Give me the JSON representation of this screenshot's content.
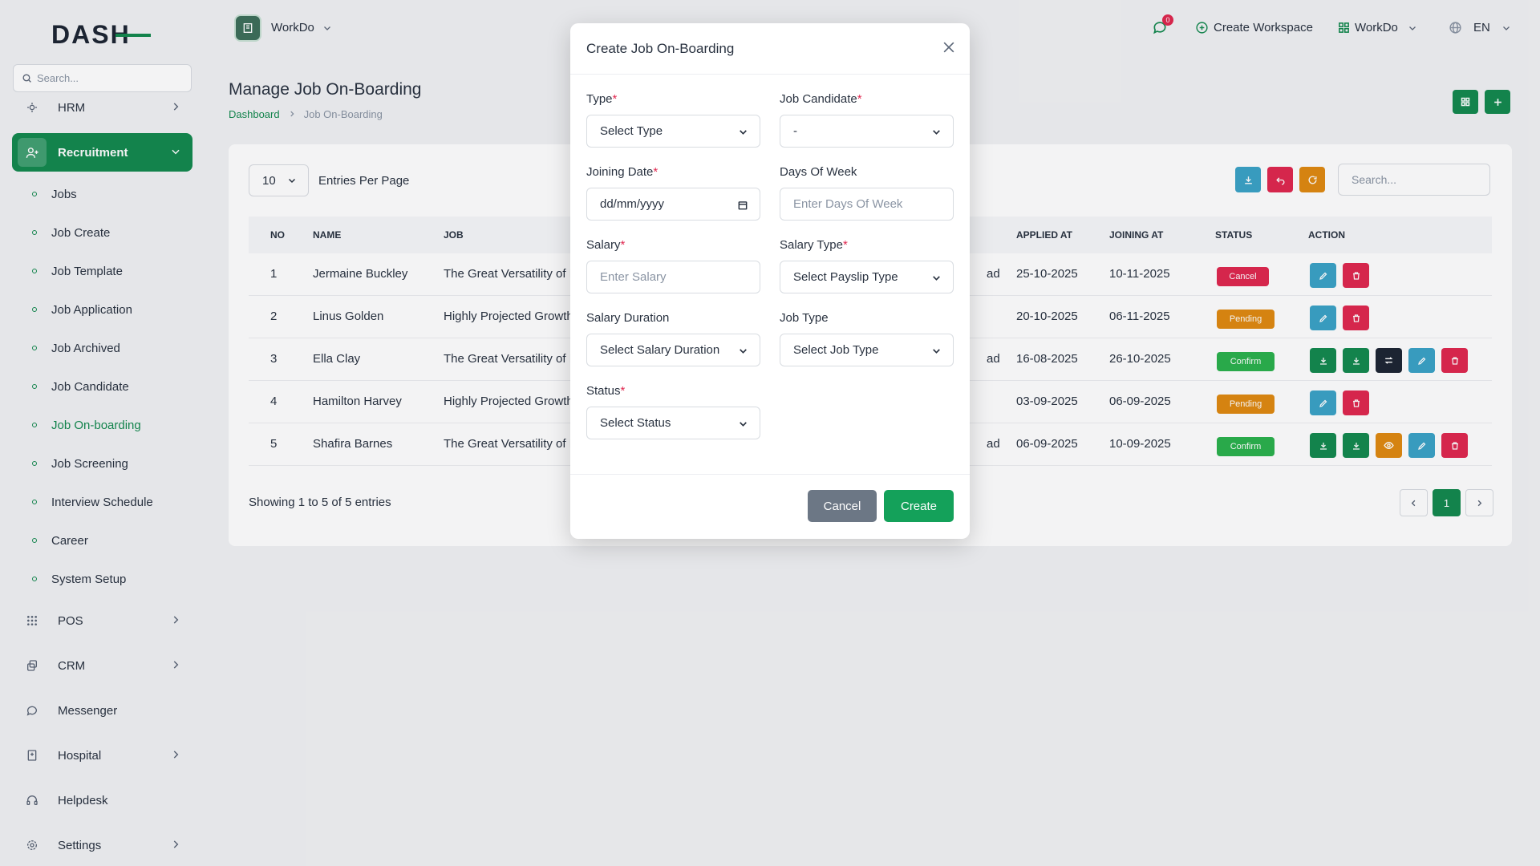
{
  "brand": {
    "logo_text": "DASH"
  },
  "sidebar": {
    "search_placeholder": "Search...",
    "items": [
      {
        "label": "HRM"
      },
      {
        "label": "Recruitment"
      },
      {
        "label": "POS"
      },
      {
        "label": "CRM"
      },
      {
        "label": "Messenger"
      },
      {
        "label": "Hospital"
      },
      {
        "label": "Helpdesk"
      },
      {
        "label": "Settings"
      }
    ],
    "sub_items": [
      "Jobs",
      "Job Create",
      "Job Template",
      "Job Application",
      "Job Archived",
      "Job Candidate",
      "Job On-boarding",
      "Job Screening",
      "Interview Schedule",
      "Career",
      "System Setup"
    ]
  },
  "topbar": {
    "workspace": "WorkDo",
    "notifications": "0",
    "create_workspace": "Create Workspace",
    "workspace2": "WorkDo",
    "language": "EN"
  },
  "page": {
    "title": "Manage Job On-Boarding",
    "breadcrumb_home": "Dashboard",
    "breadcrumb_current": "Job On-Boarding"
  },
  "table": {
    "per_page": "10",
    "per_page_label": "Entries Per Page",
    "search_placeholder": "Search...",
    "headers": {
      "no": "NO",
      "name": "NAME",
      "job": "JOB",
      "applied": "APPLIED AT",
      "joining": "JOINING AT",
      "status": "STATUS",
      "action": "ACTION"
    },
    "rows": [
      {
        "no": "1",
        "name": "Jermaine Buckley",
        "job": "The Great Versatility of E",
        "branch": "ad",
        "applied": "25-10-2025",
        "joining": "10-11-2025",
        "status": "Cancel"
      },
      {
        "no": "2",
        "name": "Linus Golden",
        "job": "Highly Projected Growth",
        "branch": "",
        "applied": "20-10-2025",
        "joining": "06-11-2025",
        "status": "Pending"
      },
      {
        "no": "3",
        "name": "Ella Clay",
        "job": "The Great Versatility of E",
        "branch": "ad",
        "applied": "16-08-2025",
        "joining": "26-10-2025",
        "status": "Confirm"
      },
      {
        "no": "4",
        "name": "Hamilton Harvey",
        "job": "Highly Projected Growth",
        "branch": "",
        "applied": "03-09-2025",
        "joining": "06-09-2025",
        "status": "Pending"
      },
      {
        "no": "5",
        "name": "Shafira Barnes",
        "job": "The Great Versatility of E",
        "branch": "ad",
        "applied": "06-09-2025",
        "joining": "10-09-2025",
        "status": "Confirm"
      }
    ],
    "showing": "Showing 1 to 5 of 5 entries",
    "current_page": "1"
  },
  "modal": {
    "title": "Create Job On-Boarding",
    "fields": {
      "type": {
        "label": "Type",
        "value": "Select Type"
      },
      "candidate": {
        "label": "Job Candidate",
        "value": "-"
      },
      "joining_date": {
        "label": "Joining Date",
        "value": "dd/mm/yyyy"
      },
      "days_of_week": {
        "label": "Days Of Week",
        "placeholder": "Enter Days Of Week"
      },
      "salary": {
        "label": "Salary",
        "placeholder": "Enter Salary"
      },
      "salary_type": {
        "label": "Salary Type",
        "value": "Select Payslip Type"
      },
      "salary_duration": {
        "label": "Salary Duration",
        "value": "Select Salary Duration"
      },
      "job_type": {
        "label": "Job Type",
        "value": "Select Job Type"
      },
      "status": {
        "label": "Status",
        "value": "Select Status"
      }
    },
    "required_mark": "*",
    "cancel": "Cancel",
    "create": "Create"
  },
  "colors": {
    "primary": "#138a4f",
    "danger": "#e0284f",
    "warning": "#e08a10",
    "success": "#2bb24c",
    "info": "#3aa3c7"
  }
}
